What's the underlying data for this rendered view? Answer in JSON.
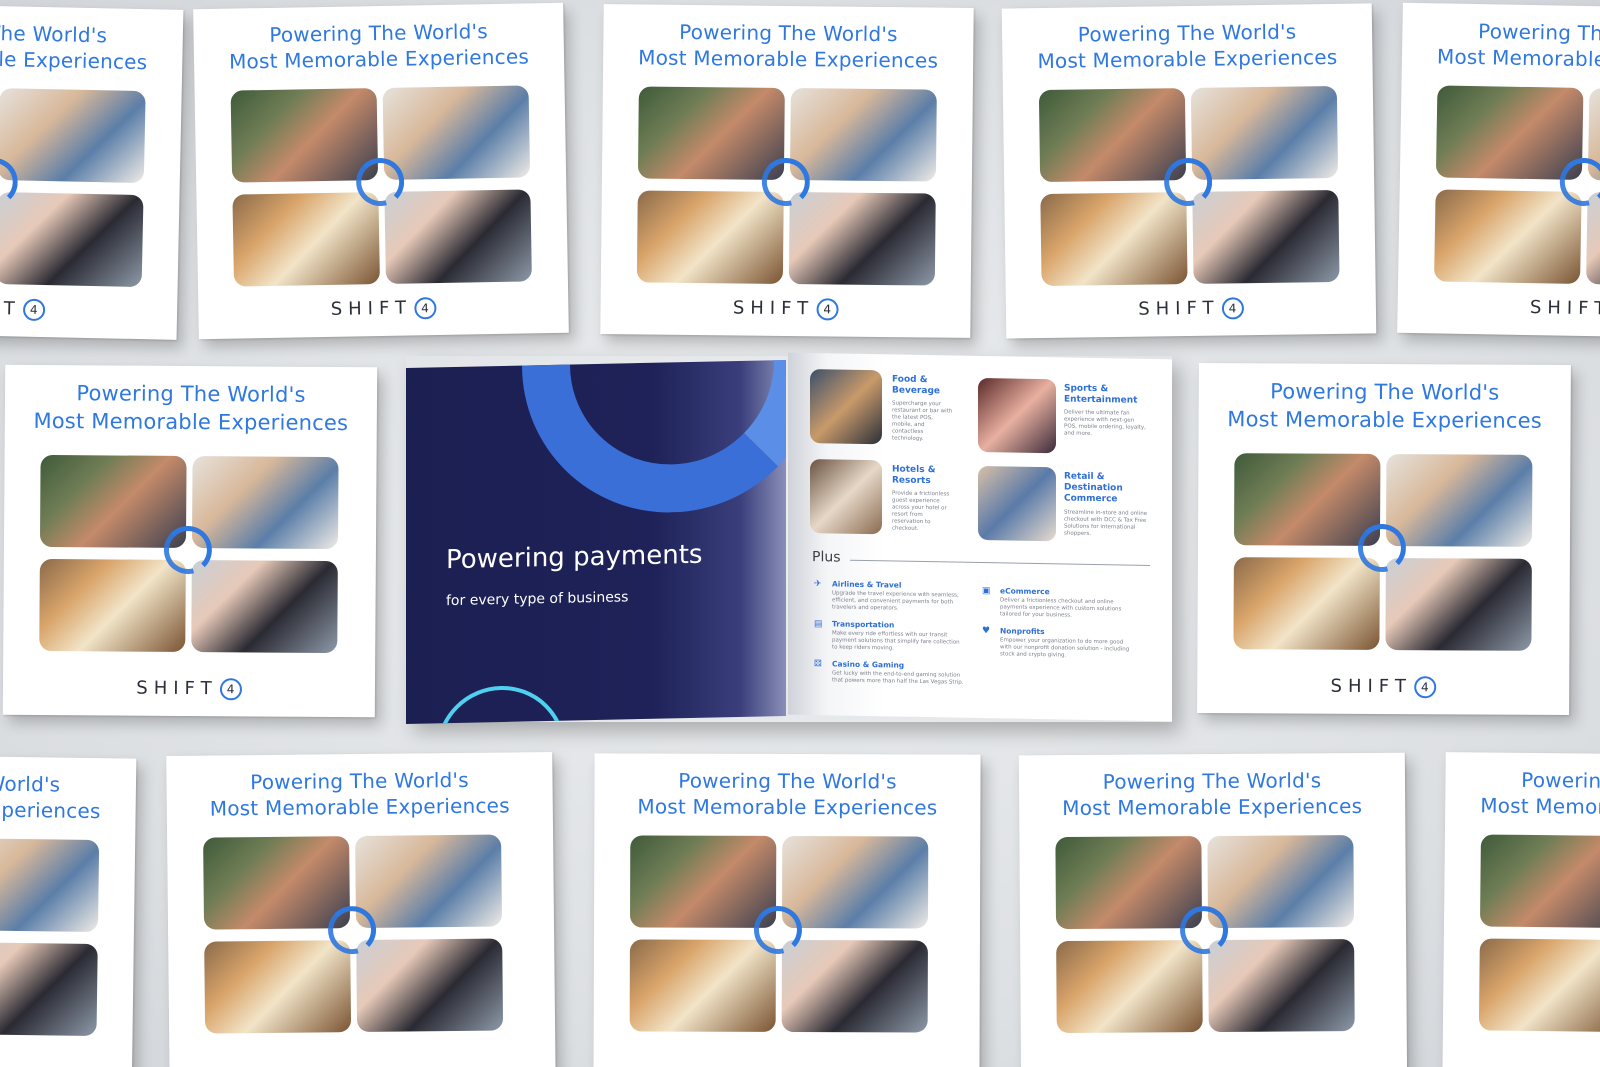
{
  "cover": {
    "title_line1": "Powering The World's",
    "title_line2": "Most Memorable Experiences",
    "logo_text": "SHIFT",
    "logo_mark": "4"
  },
  "spread": {
    "left": {
      "headline": "Powering payments",
      "subheadline": "for every type of business"
    },
    "segments": [
      {
        "title": "Food & Beverage",
        "desc": "Supercharge your restaurant or bar with the latest POS, mobile, and contactless technology."
      },
      {
        "title": "Sports & Entertainment",
        "desc": "Deliver the ultimate fan experience with next-gen POS, mobile ordering, loyalty, and more."
      },
      {
        "title": "Hotels & Resorts",
        "desc": "Provide a frictionless guest experience across your hotel or resort from reservation to checkout."
      },
      {
        "title": "Retail & Destination Commerce",
        "desc": "Streamline in-store and online checkout with DCC & Tax Free Solutions for international shoppers."
      }
    ],
    "plus_label": "Plus",
    "plus_items": [
      {
        "icon": "airplane-icon",
        "title": "Airlines & Travel",
        "desc": "Upgrade the travel experience with seamless, efficient, and convenient payments for both travelers and operators."
      },
      {
        "icon": "cart-icon",
        "title": "eCommerce",
        "desc": "Deliver a frictionless checkout and online payments experience with custom solutions tailored for your business."
      },
      {
        "icon": "bus-icon",
        "title": "Transportation",
        "desc": "Make every ride effortless with our transit payment solutions that simplify fare collection to keep riders moving."
      },
      {
        "icon": "heart-hand-icon",
        "title": "Nonprofits",
        "desc": "Empower your organization to do more good with our nonprofit donation solution - including stock and crypto giving."
      },
      {
        "icon": "dice-icon",
        "title": "Casino & Gaming",
        "desc": "Get lucky with the end-to-end gaming solution that powers more than half the Las Vegas Strip."
      }
    ]
  },
  "colors": {
    "brand_blue": "#2f78e0",
    "navy": "#1b1f52",
    "cyan_accent": "#4fd0f0"
  }
}
